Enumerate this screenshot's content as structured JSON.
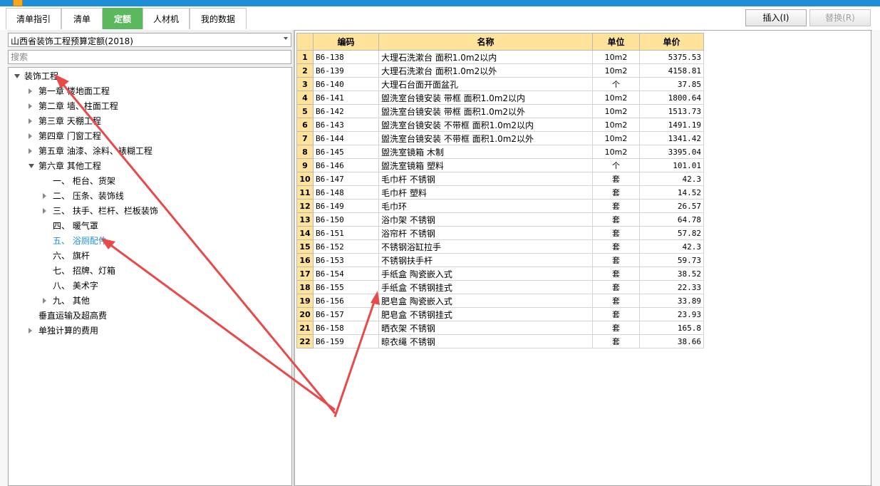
{
  "tabs": [
    {
      "label": "清单指引",
      "active": false
    },
    {
      "label": "清单",
      "active": false
    },
    {
      "label": "定额",
      "active": true
    },
    {
      "label": "人材机",
      "active": false
    },
    {
      "label": "我的数据",
      "active": false
    }
  ],
  "toolbar": {
    "insert_label": "插入(I)",
    "replace_label": "替换(R)"
  },
  "left": {
    "quota_library": "山西省装饰工程预算定额(2018)",
    "search_placeholder": "搜索"
  },
  "tree": [
    {
      "label": "装饰工程",
      "expanded": true
    },
    {
      "label": "第一章 楼地面工程",
      "expanded": false
    },
    {
      "label": "第二章 墙、柱面工程",
      "expanded": false
    },
    {
      "label": "第三章 天棚工程",
      "expanded": false
    },
    {
      "label": "第四章 门窗工程",
      "expanded": false
    },
    {
      "label": "第五章 油漆、涂料、裱糊工程",
      "expanded": false
    },
    {
      "label": "第六章 其他工程",
      "expanded": true
    },
    {
      "label": "一、 柜台、货架"
    },
    {
      "label": "二、 压条、装饰线",
      "expanded": false
    },
    {
      "label": "三、 扶手、栏杆、栏板装饰",
      "expanded": false
    },
    {
      "label": "四、 暖气罩"
    },
    {
      "label": "五、 浴厕配件",
      "selected": true
    },
    {
      "label": "六、 旗杆"
    },
    {
      "label": "七、 招牌、灯箱"
    },
    {
      "label": "八、 美术字"
    },
    {
      "label": "九、 其他",
      "expanded": false
    },
    {
      "label": "垂直运输及超高费"
    },
    {
      "label": "单独计算的费用",
      "expanded": false
    }
  ],
  "grid": {
    "headers": {
      "code": "编码",
      "name": "名称",
      "unit": "单位",
      "price": "单价"
    },
    "rows": [
      {
        "n": "1",
        "code": "B6-138",
        "name": "大理石洗漱台 面积1.0m2以内",
        "unit": "10m2",
        "price": "5375.53"
      },
      {
        "n": "2",
        "code": "B6-139",
        "name": "大理石洗漱台 面积1.0m2以外",
        "unit": "10m2",
        "price": "4158.81"
      },
      {
        "n": "3",
        "code": "B6-140",
        "name": "大理石台面开面盆孔",
        "unit": "个",
        "price": "37.85"
      },
      {
        "n": "4",
        "code": "B6-141",
        "name": "盥洗室台镜安装 带框 面积1.0m2以内",
        "unit": "10m2",
        "price": "1800.64"
      },
      {
        "n": "5",
        "code": "B6-142",
        "name": "盥洗室台镜安装 带框 面积1.0m2以外",
        "unit": "10m2",
        "price": "1513.73"
      },
      {
        "n": "6",
        "code": "B6-143",
        "name": "盥洗室台镜安装 不带框 面积1.0m2以内",
        "unit": "10m2",
        "price": "1491.19"
      },
      {
        "n": "7",
        "code": "B6-144",
        "name": "盥洗室台镜安装 不带框 面积1.0m2以外",
        "unit": "10m2",
        "price": "1341.42"
      },
      {
        "n": "8",
        "code": "B6-145",
        "name": "盥洗室镜箱 木制",
        "unit": "10m2",
        "price": "3395.04"
      },
      {
        "n": "9",
        "code": "B6-146",
        "name": "盥洗室镜箱 塑料",
        "unit": "个",
        "price": "101.01"
      },
      {
        "n": "10",
        "code": "B6-147",
        "name": "毛巾杆 不锈钢",
        "unit": "套",
        "price": "42.3"
      },
      {
        "n": "11",
        "code": "B6-148",
        "name": "毛巾杆 塑料",
        "unit": "套",
        "price": "14.52"
      },
      {
        "n": "12",
        "code": "B6-149",
        "name": "毛巾环",
        "unit": "套",
        "price": "26.57"
      },
      {
        "n": "13",
        "code": "B6-150",
        "name": "浴巾架 不锈钢",
        "unit": "套",
        "price": "64.78"
      },
      {
        "n": "14",
        "code": "B6-151",
        "name": "浴帘杆 不锈钢",
        "unit": "套",
        "price": "57.82"
      },
      {
        "n": "15",
        "code": "B6-152",
        "name": "不锈钢浴缸拉手",
        "unit": "套",
        "price": "42.3"
      },
      {
        "n": "16",
        "code": "B6-153",
        "name": "不锈钢扶手杆",
        "unit": "套",
        "price": "59.73"
      },
      {
        "n": "17",
        "code": "B6-154",
        "name": "手纸盒 陶瓷嵌入式",
        "unit": "套",
        "price": "38.52"
      },
      {
        "n": "18",
        "code": "B6-155",
        "name": "手纸盒 不锈钢挂式",
        "unit": "套",
        "price": "22.33"
      },
      {
        "n": "19",
        "code": "B6-156",
        "name": "肥皂盒 陶瓷嵌入式",
        "unit": "套",
        "price": "33.89"
      },
      {
        "n": "20",
        "code": "B6-157",
        "name": "肥皂盒 不锈钢挂式",
        "unit": "套",
        "price": "23.93"
      },
      {
        "n": "21",
        "code": "B6-158",
        "name": "晒衣架 不锈钢",
        "unit": "套",
        "price": "165.8"
      },
      {
        "n": "22",
        "code": "B6-159",
        "name": "晾衣绳 不锈钢",
        "unit": "套",
        "price": "38.66"
      }
    ]
  },
  "colors": {
    "active_tab": "#5cb85c",
    "header_bg": "#ffe39a",
    "selected_node": "#1e8fd6",
    "annotation_arrow": "#e84a4a",
    "grid_frame": "#3aa0d8"
  }
}
